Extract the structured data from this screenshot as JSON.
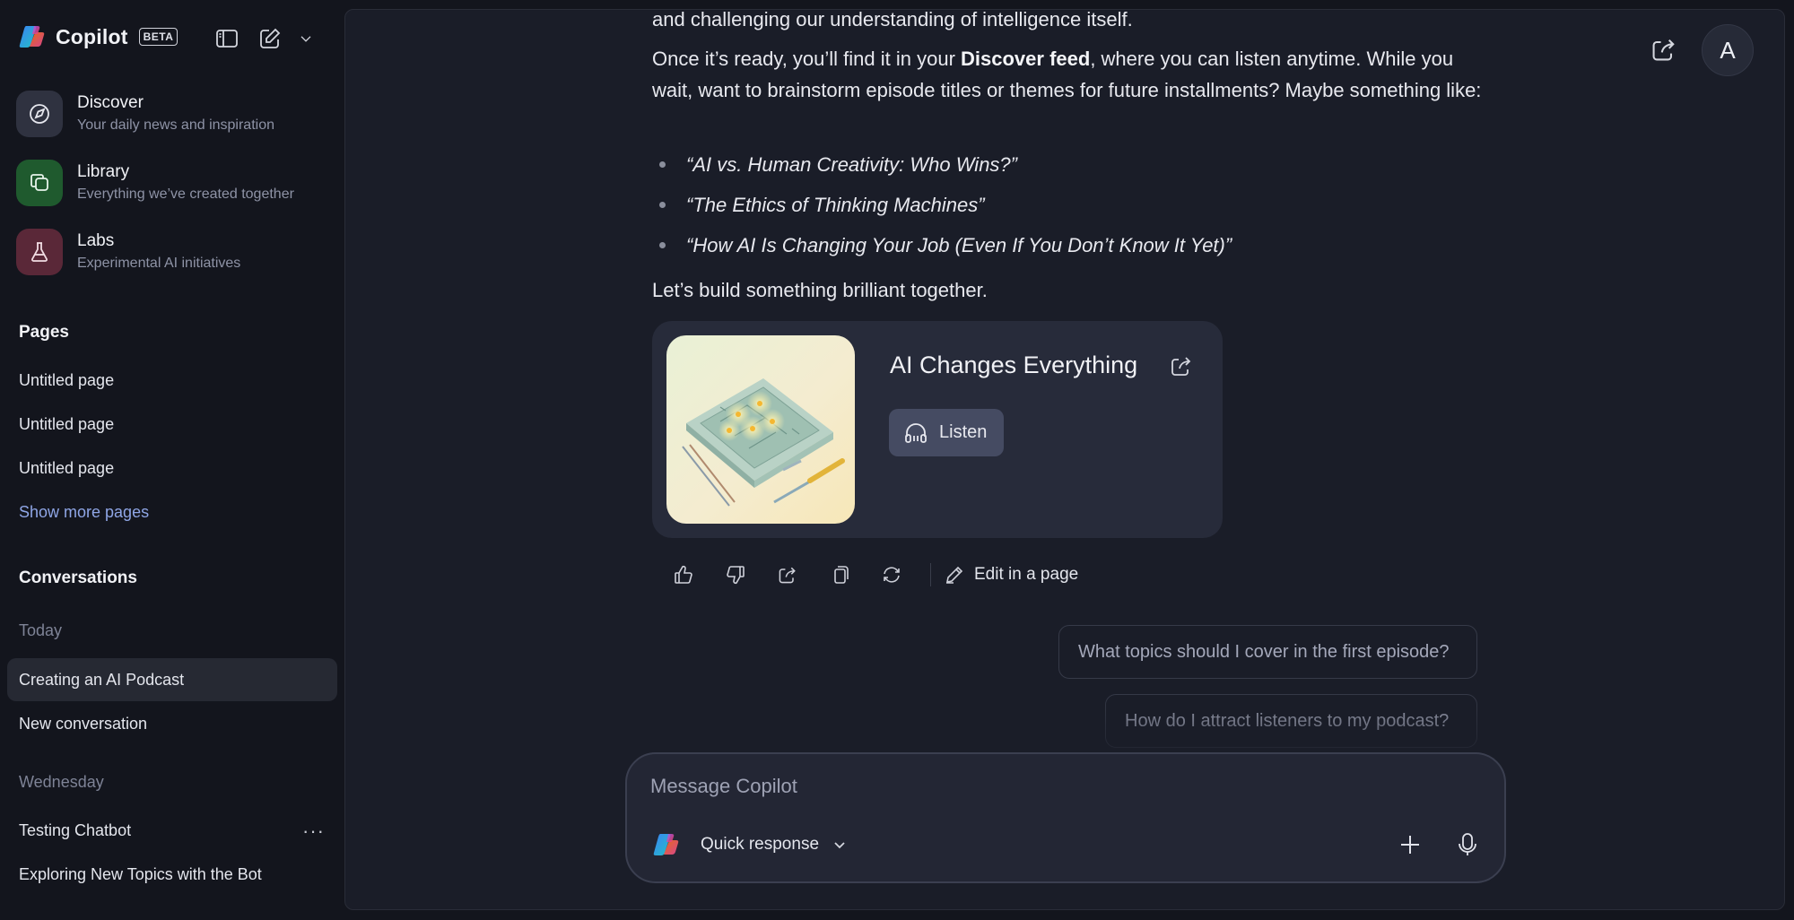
{
  "app": {
    "name": "Copilot",
    "badge": "BETA"
  },
  "sidebar": {
    "nav": [
      {
        "title": "Discover",
        "subtitle": "Your daily news and inspiration",
        "icon": "compass-icon",
        "color": "#2f3240"
      },
      {
        "title": "Library",
        "subtitle": "Everything we’ve created together",
        "icon": "library-icon",
        "color": "#1f5a2e"
      },
      {
        "title": "Labs",
        "subtitle": "Experimental AI initiatives",
        "icon": "flask-icon",
        "color": "#5a2838"
      }
    ],
    "pages_title": "Pages",
    "pages": [
      "Untitled page",
      "Untitled page",
      "Untitled page"
    ],
    "show_more": "Show more pages",
    "conversations_title": "Conversations",
    "today_label": "Today",
    "today": [
      "Creating an AI Podcast",
      "New conversation"
    ],
    "wednesday_label": "Wednesday",
    "wednesday": [
      "Testing Chatbot",
      "Exploring New Topics with the Bot"
    ],
    "more_dots": "···"
  },
  "chat": {
    "top_cut_line": "and challenging our understanding of intelligence itself.",
    "para1_pre": "Once it’s ready, you’ll find it in your ",
    "para1_bold": "Discover feed",
    "para1_post": ", where you can listen anytime. While you wait, want to brainstorm episode titles or themes for future installments? Maybe something like:",
    "bullets": [
      "“AI vs. Human Creativity: Who Wins?”",
      "“The Ethics of Thinking Machines”",
      "“How AI Is Changing Your Job (Even If You Don’t Know It Yet)”"
    ],
    "closing": "Let’s build something brilliant together.",
    "podcast": {
      "title": "AI Changes Everything",
      "listen_label": "Listen"
    },
    "actions": {
      "edit_label": "Edit in a page"
    },
    "suggestions": [
      "What topics should I cover in the first episode?",
      "How do I attract listeners to my podcast?"
    ]
  },
  "composer": {
    "placeholder": "Message Copilot",
    "mode": "Quick response"
  },
  "user": {
    "avatar_initial": "A"
  },
  "colors": {
    "background": "#13151d",
    "main_panel": "#1a1d28",
    "accent_link": "#8fa6e6",
    "active_item": "#262933"
  }
}
